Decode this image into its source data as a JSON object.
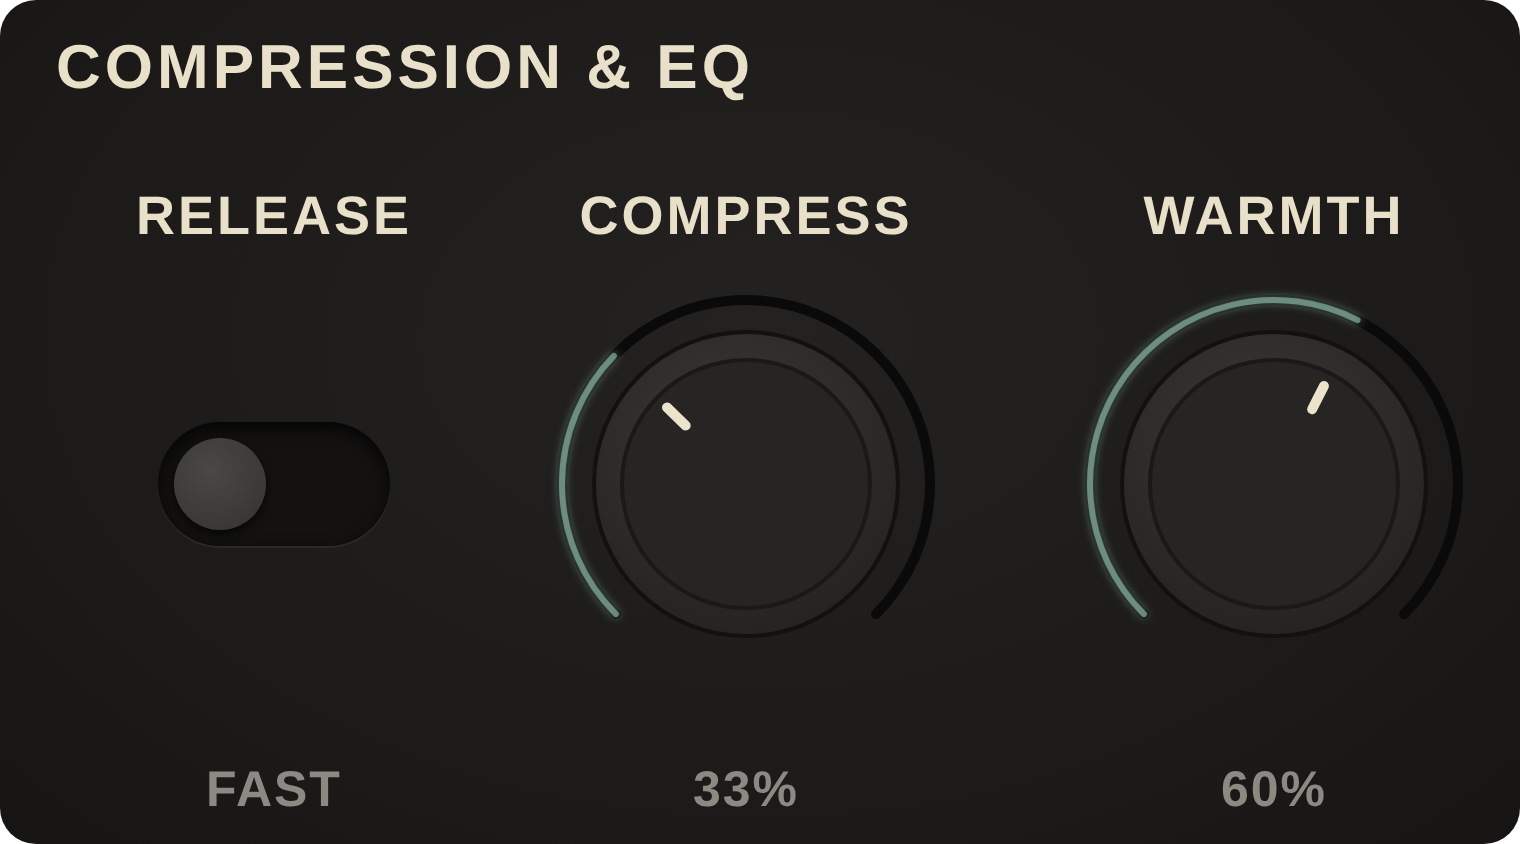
{
  "title": "COMPRESSION & EQ",
  "controls": [
    {
      "kind": "toggle",
      "label": "RELEASE",
      "on": false,
      "value": "FAST"
    },
    {
      "kind": "knob",
      "label": "COMPRESS",
      "value": "33%"
    },
    {
      "kind": "knob",
      "label": "WARMTH",
      "value": "60%"
    }
  ]
}
